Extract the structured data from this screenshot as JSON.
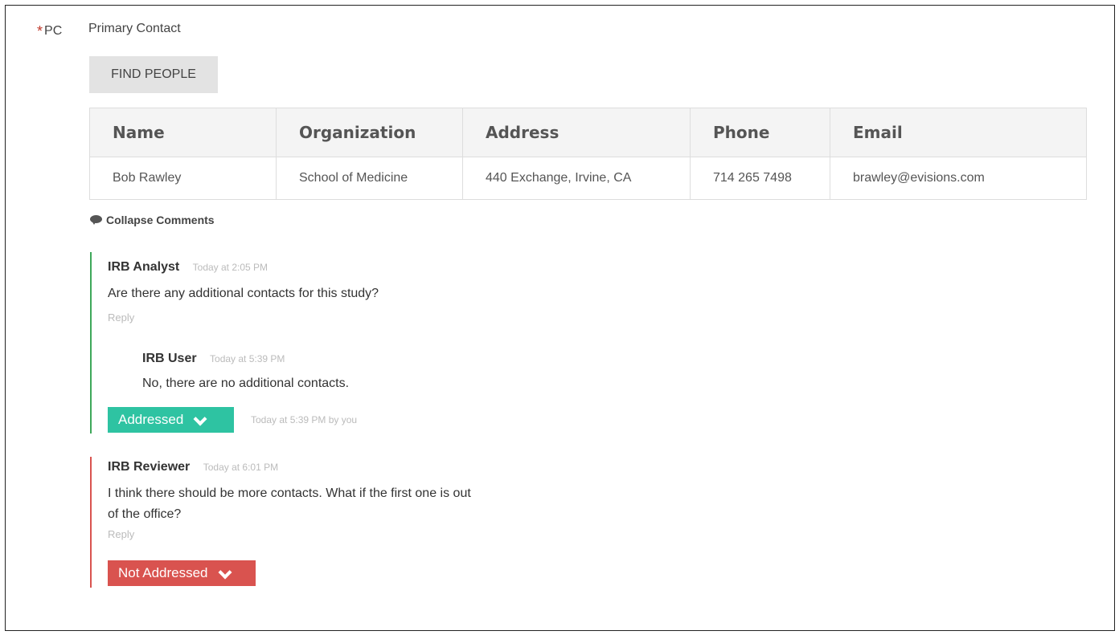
{
  "question": {
    "required_mark": "*",
    "code": "PC",
    "title": "Primary Contact",
    "find_button": "FIND PEOPLE"
  },
  "table": {
    "headers": [
      "Name",
      "Organization",
      "Address",
      "Phone",
      "Email"
    ],
    "rows": [
      [
        "Bob Rawley",
        "School of Medicine",
        "440 Exchange, Irvine, CA",
        "714 265 7498",
        "brawley@evisions.com"
      ]
    ]
  },
  "comments": {
    "collapse_label": "Collapse Comments",
    "threads": [
      {
        "author": "IRB Analyst",
        "time": "Today at 2:05 PM",
        "text": "Are there any additional contacts for this study?",
        "reply": "Reply",
        "reply_item": {
          "author": "IRB User",
          "time": "Today at 5:39 PM",
          "text": "No, there are no additional contacts."
        },
        "status": "Addressed",
        "status_meta": "Today at 5:39 PM by you",
        "status_color": "#2ec3a2",
        "thread_color": "#3ea85a"
      },
      {
        "author": "IRB Reviewer",
        "time": "Today at 6:01 PM",
        "text_line1": "I think there should be more contacts.  What if the first one is out",
        "text_line2": "of the office?",
        "reply": "Reply",
        "status": "Not Addressed",
        "status_color": "#d9534f",
        "thread_color": "#d9534f"
      }
    ]
  }
}
